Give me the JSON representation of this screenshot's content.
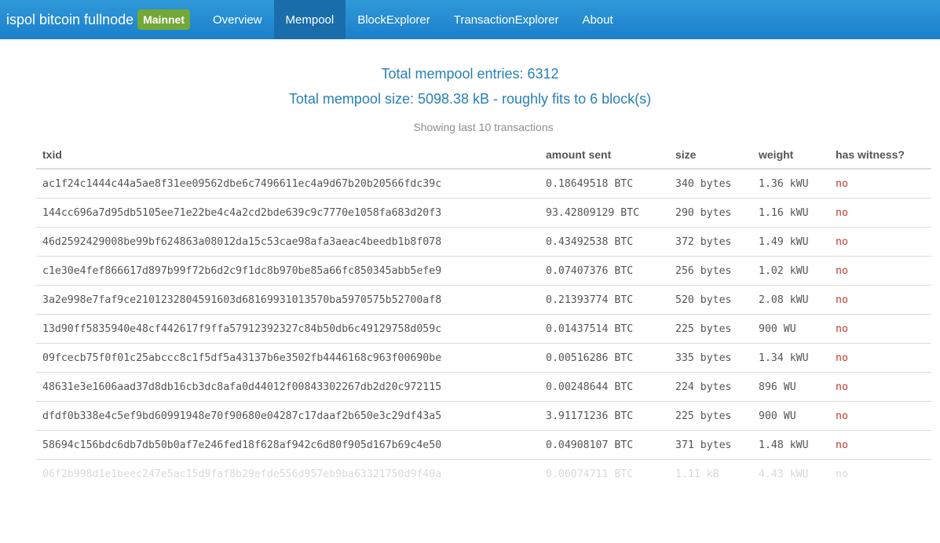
{
  "navbar": {
    "title": "ispol bitcoin fullnode",
    "network_badge": "Mainnet",
    "items": [
      {
        "label": "Overview",
        "active": false
      },
      {
        "label": "Mempool",
        "active": true
      },
      {
        "label": "BlockExplorer",
        "active": false
      },
      {
        "label": "TransactionExplorer",
        "active": false
      },
      {
        "label": "About",
        "active": false
      }
    ]
  },
  "summary": {
    "entries": "Total mempool entries: 6312",
    "size": "Total mempool size: 5098.38 kB - roughly fits to 6 block(s)",
    "caption": "Showing last 10 transactions"
  },
  "table": {
    "headers": [
      "txid",
      "amount sent",
      "size",
      "weight",
      "has witness?"
    ],
    "rows": [
      [
        "ac1f24c1444c44a5ae8f31ee09562dbe6c7496611ec4a9d67b20b20566fdc39c",
        "0.18649518 BTC",
        "340 bytes",
        "1.36 kWU",
        "no"
      ],
      [
        "144cc696a7d95db5105ee71e22be4c4a2cd2bde639c9c7770e1058fa683d20f3",
        "93.42809129 BTC",
        "290 bytes",
        "1.16 kWU",
        "no"
      ],
      [
        "46d2592429008be99bf624863a08012da15c53cae98afa3aeac4beedb1b8f078",
        "0.43492538 BTC",
        "372 bytes",
        "1.49 kWU",
        "no"
      ],
      [
        "c1e30e4fef866617d897b99f72b6d2c9f1dc8b970be85a66fc850345abb5efe9",
        "0.07407376 BTC",
        "256 bytes",
        "1.02 kWU",
        "no"
      ],
      [
        "3a2e998e7faf9ce2101232804591603d68169931013570ba5970575b52700af8",
        "0.21393774 BTC",
        "520 bytes",
        "2.08 kWU",
        "no"
      ],
      [
        "13d90ff5835940e48cf442617f9ffa57912392327c84b50db6c49129758d059c",
        "0.01437514 BTC",
        "225 bytes",
        "900 WU",
        "no"
      ],
      [
        "09fcecb75f0f01c25abccc8c1f5df5a43137b6e3502fb4446168c963f00690be",
        "0.00516286 BTC",
        "335 bytes",
        "1.34 kWU",
        "no"
      ],
      [
        "48631e3e1606aad37d8db16cb3dc8afa0d44012f00843302267db2d20c972115",
        "0.00248644 BTC",
        "224 bytes",
        "896 WU",
        "no"
      ],
      [
        "dfdf0b338e4c5ef9bd60991948e70f90680e04287c17daaf2b650e3c29df43a5",
        "3.91171236 BTC",
        "225 bytes",
        "900 WU",
        "no"
      ],
      [
        "58694c156bdc6db7db50b0af7e246fed18f628af942c6d80f905d167b69c4e50",
        "0.04908107 BTC",
        "371 bytes",
        "1.48 kWU",
        "no"
      ],
      [
        "06f2b998d1e1beec247e5ac15d9faf8b29efde556d957eb9ba63321750d9f40a",
        "0.00074711 BTC",
        "1.11 kB",
        "4.43 kWU",
        "no"
      ]
    ]
  },
  "colors": {
    "navbar": "#2a8fd3",
    "active_nav": "#1a6dab",
    "badge": "#73a839",
    "summary_text": "#2780b8",
    "no_text": "#c0392b"
  }
}
